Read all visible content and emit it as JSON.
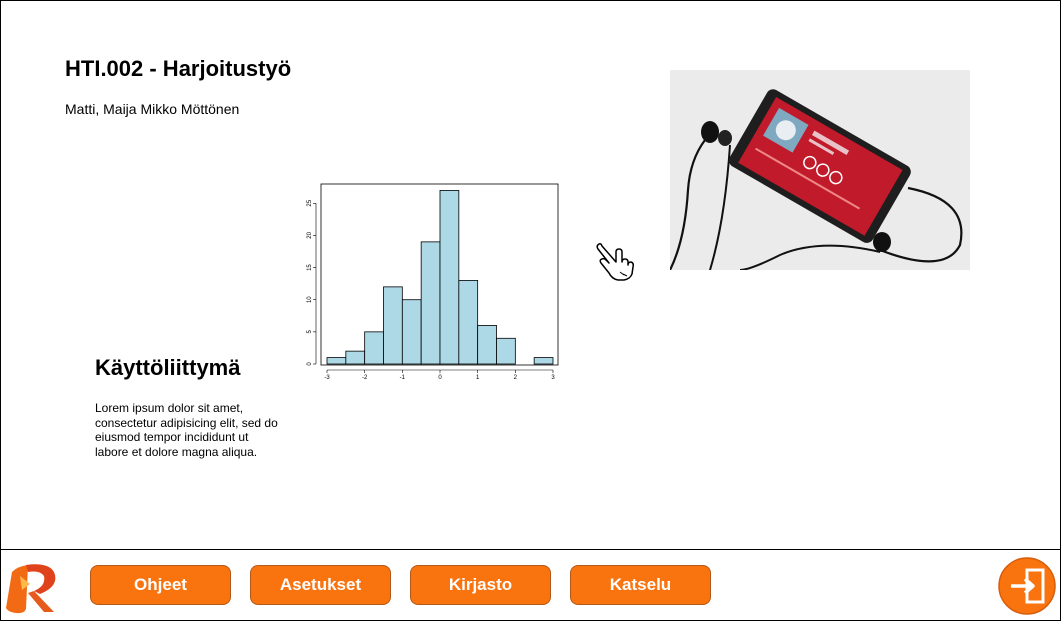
{
  "header": {
    "title": "HTI.002 - Harjoitustyö",
    "authors": "Matti, Maija Mikko Möttönen"
  },
  "main": {
    "heading": "Käyttöliittymä",
    "body": "Lorem ipsum dolor sit amet, consectetur adipisicing elit, sed do eiusmod tempor incididunt ut labore et dolore magna aliqua."
  },
  "chart_data": {
    "type": "bar",
    "bin_edges": [
      -3,
      -2.5,
      -2,
      -1.5,
      -1,
      -0.5,
      0,
      0.5,
      1,
      1.5,
      2,
      2.5,
      3
    ],
    "values": [
      1,
      2,
      5,
      12,
      10,
      19,
      27,
      13,
      6,
      4,
      0,
      1
    ],
    "xticks": [
      -3,
      -2,
      -1,
      0,
      1,
      2,
      3
    ],
    "yticks": [
      0,
      5,
      10,
      15,
      20,
      25
    ],
    "xlim": [
      -3,
      3
    ],
    "ylim": [
      0,
      28
    ],
    "bar_color": "#add8e6",
    "title": "",
    "xlabel": "",
    "ylabel": ""
  },
  "footer": {
    "buttons": [
      "Ohjeet",
      "Asetukset",
      "Kirjasto",
      "Katselu"
    ],
    "button_color": "#f9730f"
  },
  "icons": {
    "logo": "app-logo",
    "exit": "exit-icon",
    "cursor": "hand-cursor-icon"
  }
}
